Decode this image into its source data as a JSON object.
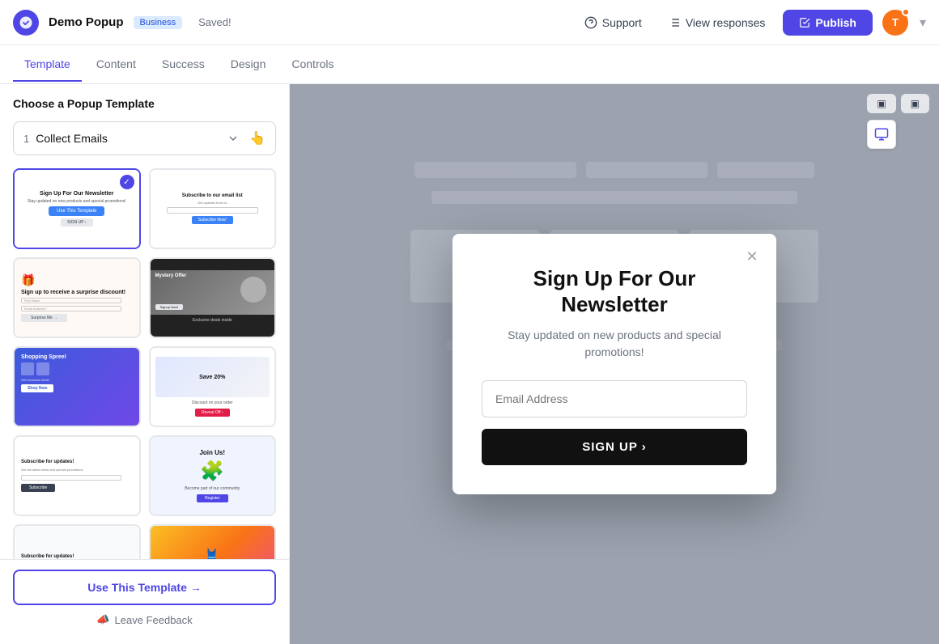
{
  "app": {
    "name": "Demo Popup",
    "badge": "Business",
    "saved_status": "Saved!"
  },
  "topbar": {
    "support_label": "Support",
    "view_responses_label": "View responses",
    "publish_label": "Publish",
    "avatar_initials": "T"
  },
  "tabs": [
    {
      "id": "template",
      "label": "Template",
      "active": true
    },
    {
      "id": "content",
      "label": "Content",
      "active": false
    },
    {
      "id": "success",
      "label": "Success",
      "active": false
    },
    {
      "id": "design",
      "label": "Design",
      "active": false
    },
    {
      "id": "controls",
      "label": "Controls",
      "active": false
    }
  ],
  "sidebar": {
    "heading": "Choose a Popup Template",
    "dropdown": {
      "number": "1",
      "label": "Collect Emails"
    },
    "use_template_label": "Use This Template →",
    "leave_feedback_label": "Leave Feedback"
  },
  "popup": {
    "title": "Sign Up For Our Newsletter",
    "subtitle": "Stay updated on new products and special promotions!",
    "email_placeholder": "Email Address",
    "signup_label": "SIGN UP  ›"
  }
}
